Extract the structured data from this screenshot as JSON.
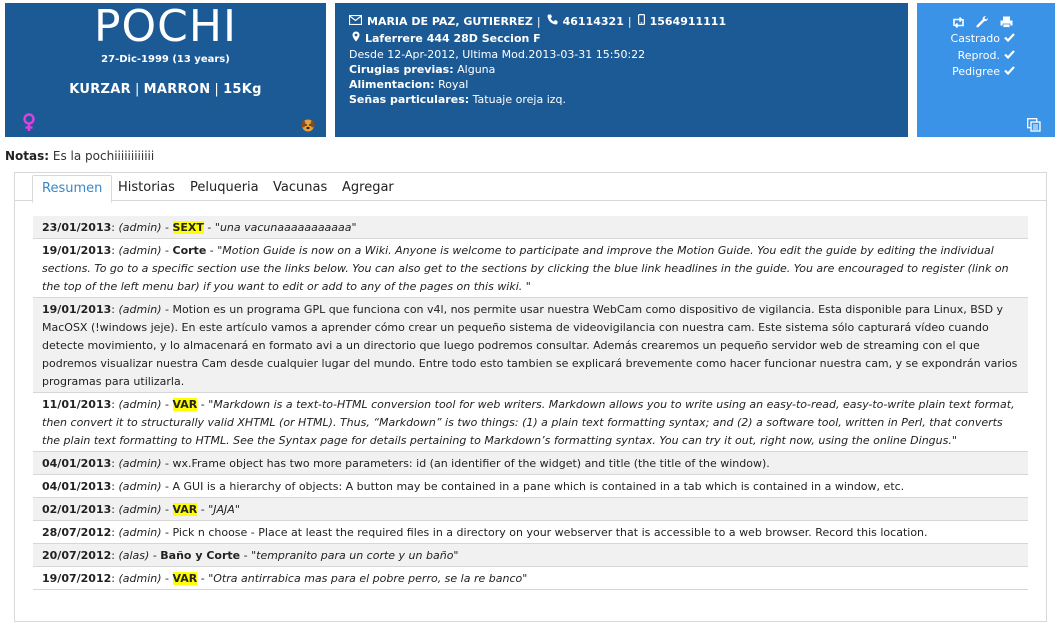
{
  "pet": {
    "name": "POCHI",
    "dob": "27-Dic-1999 (13 years)",
    "breed": "KURZAR",
    "color": "MARRON",
    "weight": "15Kg",
    "sex_icon": "female-icon",
    "species_icon": "dog-icon"
  },
  "owner": {
    "name": "MARIA DE PAZ, GUTIERREZ",
    "phone": "46114321",
    "mobile": "1564911111",
    "address": "Laferrere 444 28D Seccion F",
    "since": "Desde 12-Apr-2012, Ultima Mod.2013-03-31 15:50:22",
    "fields": [
      {
        "label": "Cirugias previas:",
        "value": "Alguna"
      },
      {
        "label": "Alimentacion:",
        "value": "Royal"
      },
      {
        "label": "Señas particulares:",
        "value": "Tatuaje oreja izq."
      }
    ]
  },
  "status": {
    "items": [
      {
        "label": "Castrado",
        "icon": "check-icon"
      },
      {
        "label": "Reprod.",
        "icon": "check-icon"
      },
      {
        "label": "Pedigree",
        "icon": "check-icon"
      }
    ]
  },
  "notes": {
    "label": "Notas:",
    "text": "Es la pochiiiiiiiiiiii"
  },
  "tabs": [
    {
      "label": "Resumen",
      "active": true
    },
    {
      "label": "Historias",
      "active": false
    },
    {
      "label": "Peluqueria",
      "active": false
    },
    {
      "label": "Vacunas",
      "active": false
    },
    {
      "label": "Agregar",
      "active": false
    }
  ],
  "entries": [
    {
      "date": "23/01/2013",
      "user": "(admin)",
      "type": "SEXT",
      "highlight": true,
      "text": "\"una vacunaaaaaaaaaaa\"",
      "italic": true
    },
    {
      "date": "19/01/2013",
      "user": "(admin)",
      "type": "Corte",
      "highlight": false,
      "text": "\"Motion Guide is now on a Wiki. Anyone is welcome to participate and improve the Motion Guide. You edit the guide by editing the individual sections. To go to a specific section use the links below. You can also get to the sections by clicking the blue link headlines in the guide. You are encouraged to register (link on the top of the left menu bar) if you want to edit or add to any of the pages on this wiki. \"",
      "italic": true
    },
    {
      "date": "19/01/2013",
      "user": "(admin)",
      "type": "",
      "highlight": false,
      "text": "Motion es un programa GPL que funciona con v4l, nos permite usar nuestra WebCam como dispositivo de vigilancia. Esta disponible para Linux, BSD y MacOSX (!windows jeje). En este artículo vamos a aprender cómo crear un pequeño sistema de videovigilancia con nuestra cam. Este sistema sólo capturará vídeo cuando detecte movimiento, y lo almacenará en formato avi a un directorio que luego podremos consultar. Además crearemos un pequeño servidor web de streaming con el que podremos visualizar nuestra Cam desde cualquier lugar del mundo. Entre todo esto tambien se explicará brevemente como hacer funcionar nuestra cam, y se expondrán varios programas para utilizarla.",
      "italic": false
    },
    {
      "date": "11/01/2013",
      "user": "(admin)",
      "type": "VAR",
      "highlight": true,
      "text": "\"Markdown is a text-to-HTML conversion tool for web writers. Markdown allows you to write using an easy-to-read, easy-to-write plain text format, then convert it to structurally valid XHTML (or HTML). Thus, “Markdown” is two things: (1) a plain text formatting syntax; and (2) a software tool, written in Perl, that converts the plain text formatting to HTML. See the Syntax page for details pertaining to Markdown’s formatting syntax. You can try it out, right now, using the online Dingus.\"",
      "italic": true
    },
    {
      "date": "04/01/2013",
      "user": "(admin)",
      "type": "",
      "highlight": false,
      "text": "wx.Frame object has two more parameters: id (an identifier of the widget) and title (the title of the window).",
      "italic": false
    },
    {
      "date": "04/01/2013",
      "user": "(admin)",
      "type": "",
      "highlight": false,
      "text": "A GUI is a hierarchy of objects: A button may be contained in a pane which is contained in a tab which is contained in a window, etc.",
      "italic": false
    },
    {
      "date": "02/01/2013",
      "user": "(admin)",
      "type": "VAR",
      "highlight": true,
      "text": "\"JAJA\"",
      "italic": true
    },
    {
      "date": "28/07/2012",
      "user": "(admin)",
      "type": "",
      "highlight": false,
      "text": "Pick n choose - Place at least the required files in a directory on your webserver that is accessible to a web browser. Record this location.",
      "italic": false
    },
    {
      "date": "20/07/2012",
      "user": "(alas)",
      "type": "Baño y Corte",
      "highlight": false,
      "text": "\"tempranito para un corte y un baño\"",
      "italic": true
    },
    {
      "date": "19/07/2012",
      "user": "(admin)",
      "type": "VAR",
      "highlight": true,
      "text": "\"Otra antirrabica mas para el pobre perro, se la re banco\"",
      "italic": true
    }
  ],
  "colors": {
    "panel_dark": "#1c5a96",
    "panel_light": "#3a93e6",
    "highlight": "#ffff00",
    "tab_active": "#3a86c8",
    "female": "#e040e0"
  }
}
